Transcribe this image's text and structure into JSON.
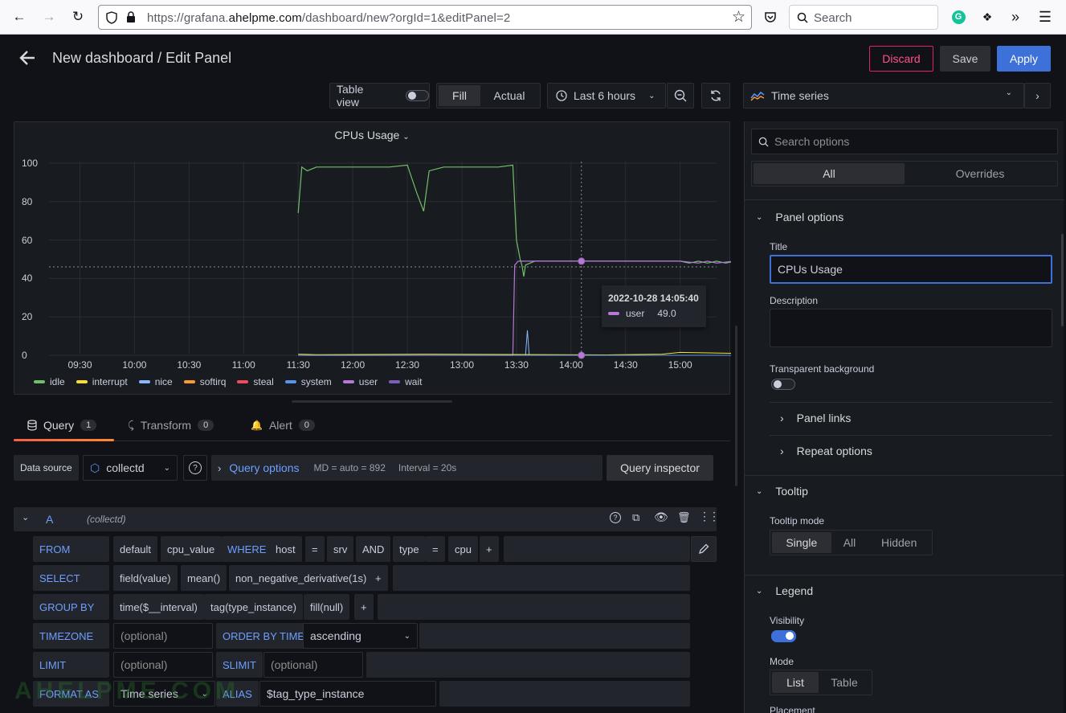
{
  "browser": {
    "url_prefix": "https://grafana.",
    "url_domain": "ahelpme.com",
    "url_path": "/dashboard/new?orgId=1&editPanel=2",
    "search_placeholder": "Search"
  },
  "header": {
    "title": "New dashboard / Edit Panel",
    "discard": "Discard",
    "save": "Save",
    "apply": "Apply"
  },
  "toolbar": {
    "table_view": "Table view",
    "fill": "Fill",
    "actual": "Actual",
    "time_range": "Last 6 hours",
    "visualization": "Time series"
  },
  "panel": {
    "title": "CPUs Usage",
    "tooltip_time": "2022-10-28 14:05:40",
    "tooltip_series": "user",
    "tooltip_value": "49.0"
  },
  "chart_data": {
    "type": "line",
    "title": "CPUs Usage",
    "y_ticks": [
      "100",
      "80",
      "60",
      "40",
      "20",
      "0"
    ],
    "x_ticks": [
      "09:30",
      "10:00",
      "10:30",
      "11:00",
      "11:30",
      "12:00",
      "12:30",
      "13:00",
      "13:30",
      "14:00",
      "14:30",
      "15:00"
    ],
    "ylim": [
      0,
      100
    ],
    "legend_position": "bottom-left",
    "series": [
      {
        "name": "idle",
        "color": "#73bf69",
        "values_desc": "~98 from 11:30 to 12:50, drops to ~50 after 12:52, ~49 until 15:10"
      },
      {
        "name": "interrupt",
        "color": "#fade2a",
        "values_desc": "~0"
      },
      {
        "name": "nice",
        "color": "#8ab8ff",
        "values_desc": "~0 with spike ~13 at 12:55"
      },
      {
        "name": "softirq",
        "color": "#ff9830",
        "values_desc": "~0"
      },
      {
        "name": "steal",
        "color": "#f2495c",
        "values_desc": "~0"
      },
      {
        "name": "system",
        "color": "#5794f2",
        "values_desc": "~0"
      },
      {
        "name": "user",
        "color": "#b877d9",
        "values_desc": "0 until 12:50, then ~49 until 15:10"
      },
      {
        "name": "wait",
        "color": "#7c5fb8",
        "values_desc": "~0"
      }
    ]
  },
  "tabs": [
    {
      "label": "Query",
      "count": "1"
    },
    {
      "label": "Transform",
      "count": "0"
    },
    {
      "label": "Alert",
      "count": "0"
    }
  ],
  "query": {
    "datasource_label": "Data source",
    "datasource": "collectd",
    "options": "Query options",
    "md": "MD = auto = 892",
    "interval": "Interval = 20s",
    "inspector": "Query inspector",
    "ref": "A",
    "ref_ds": "(collectd)",
    "from": "FROM",
    "from_vals": [
      "default",
      "cpu_value"
    ],
    "where": "WHERE",
    "where_vals": [
      "host",
      "=",
      "srv",
      "AND",
      "type",
      "=",
      "cpu",
      "+"
    ],
    "select": "SELECT",
    "select_vals": [
      "field(value)",
      "mean()",
      "non_negative_derivative(1s)",
      "+"
    ],
    "group_by": "GROUP BY",
    "group_vals": [
      "time($__interval)",
      "tag(type_instance)",
      "fill(null)",
      "+"
    ],
    "timezone": "TIMEZONE",
    "optional": "(optional)",
    "order_by_time": "ORDER BY TIME",
    "order": "ascending",
    "limit": "LIMIT",
    "slimit": "SLIMIT",
    "format_as": "FORMAT AS",
    "format": "Time series",
    "alias": "ALIAS",
    "alias_val": "$tag_type_instance"
  },
  "options": {
    "search_placeholder": "Search options",
    "all": "All",
    "overrides": "Overrides",
    "panel_options": "Panel options",
    "title_label": "Title",
    "title_value": "CPUs Usage",
    "description": "Description",
    "transparent": "Transparent background",
    "panel_links": "Panel links",
    "repeat_options": "Repeat options",
    "tooltip": "Tooltip",
    "tooltip_mode": "Tooltip mode",
    "tooltip_modes": [
      "Single",
      "All",
      "Hidden"
    ],
    "legend": "Legend",
    "visibility": "Visibility",
    "mode": "Mode",
    "modes": [
      "List",
      "Table"
    ],
    "placement": "Placement"
  },
  "watermark": "AHELPME.COM"
}
